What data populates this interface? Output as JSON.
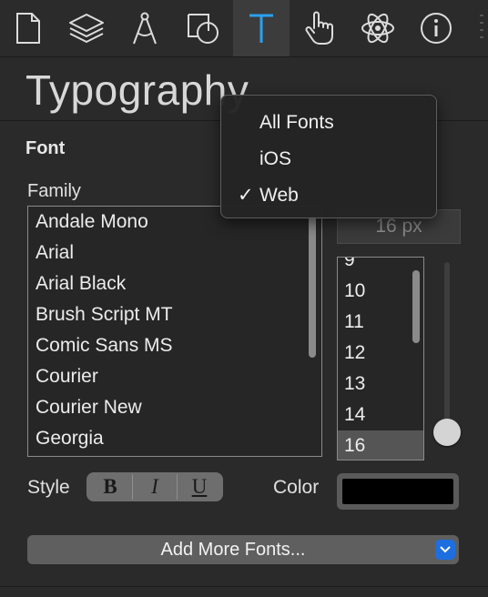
{
  "toolbar": {
    "icons": [
      "document-icon",
      "layers-icon",
      "compass-icon",
      "shapes-icon",
      "text-icon",
      "hand-pointer-icon",
      "atom-icon",
      "info-icon"
    ],
    "active": "text-icon",
    "accent": "#2aa0f0"
  },
  "panel": {
    "title": "Typography",
    "section": "Font",
    "family_label": "Family",
    "families": [
      "Andale Mono",
      "Arial",
      "Arial Black",
      "Brush Script MT",
      "Comic Sans MS",
      "Courier",
      "Courier New",
      "Georgia"
    ],
    "size_value": "16 px",
    "sizes": [
      "9",
      "10",
      "11",
      "12",
      "13",
      "14",
      "16"
    ],
    "selected_size": "16",
    "style_label": "Style",
    "style_buttons": {
      "bold": "B",
      "italic": "I",
      "underline": "U"
    },
    "color_label": "Color",
    "color_value": "#000000",
    "add_fonts_label": "Add More Fonts..."
  },
  "menu": {
    "items": [
      {
        "label": "All Fonts",
        "checked": false
      },
      {
        "label": "iOS",
        "checked": false
      },
      {
        "label": "Web",
        "checked": true
      }
    ],
    "check_glyph": "✓"
  }
}
